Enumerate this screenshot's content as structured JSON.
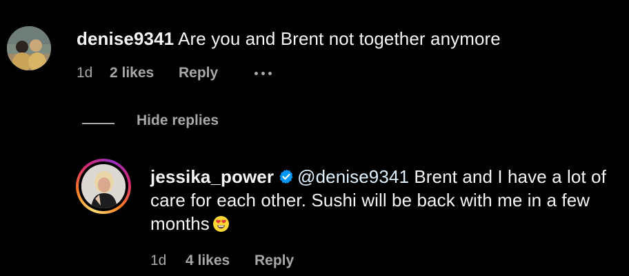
{
  "comments": [
    {
      "username": "denise9341",
      "text": "Are you and Brent not together anymore",
      "time": "1d",
      "likes": "2 likes",
      "reply_label": "Reply"
    },
    {
      "username": "jessika_power",
      "verified": true,
      "mention": "@denise9341",
      "text": "Brent and I have a lot of care for each other. Sushi will be back with me in a few months",
      "emoji": "smiling-face-with-heart-eyes",
      "time": "1d",
      "likes": "4 likes",
      "reply_label": "Reply"
    }
  ],
  "thread": {
    "hide_replies_label": "Hide replies"
  },
  "colors": {
    "background": "#000000",
    "text_primary": "#f5f5f5",
    "text_secondary": "#a8a8a8",
    "verified_badge": "#0095f6",
    "mention": "#e0f1ff"
  }
}
